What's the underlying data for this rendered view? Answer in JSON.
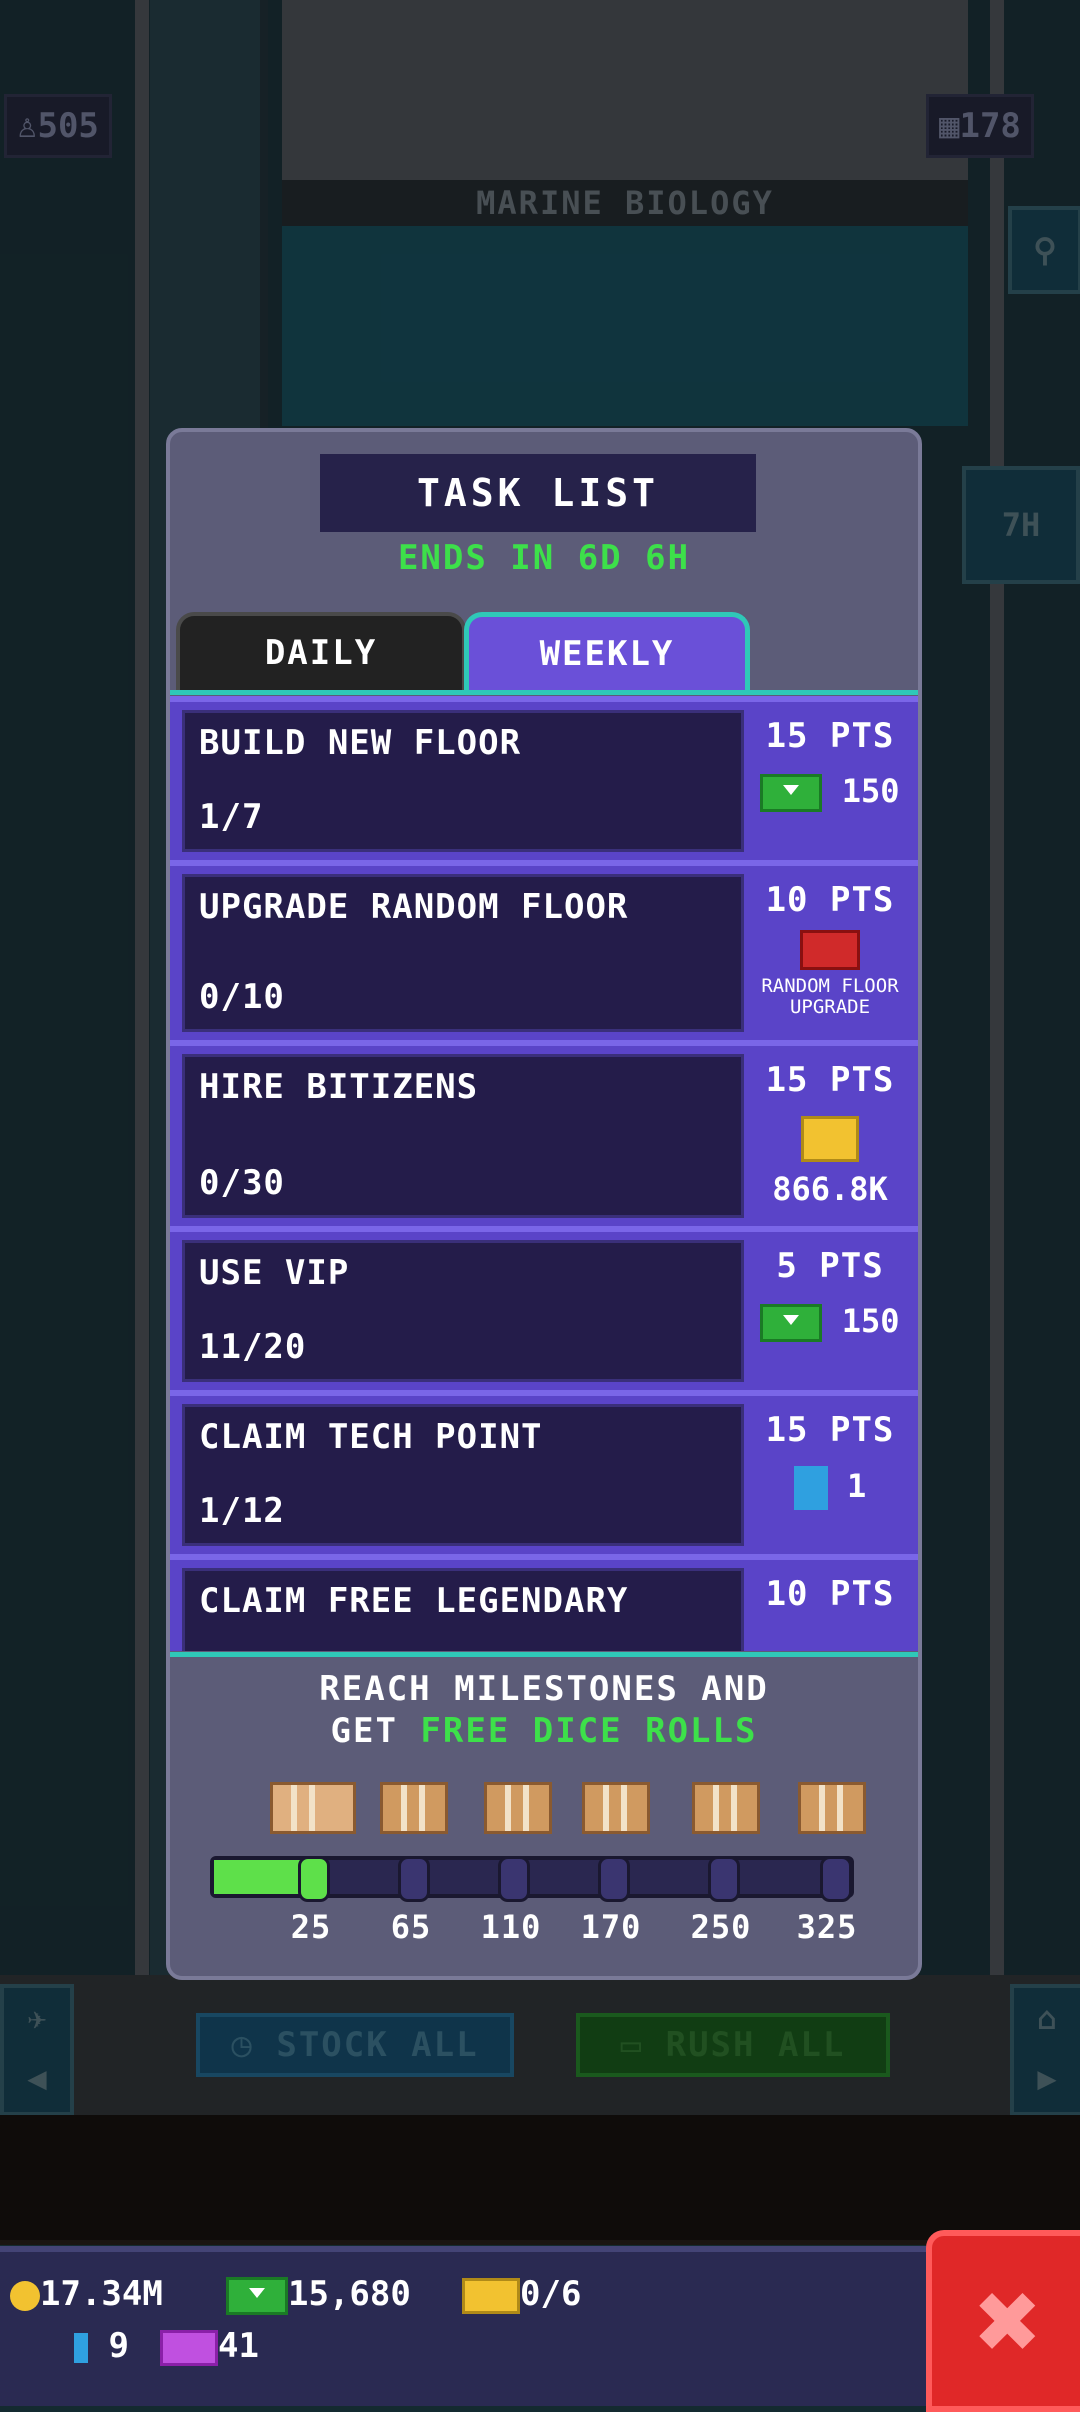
{
  "hud": {
    "population": "505",
    "floors": "178",
    "timer_badge": "7H",
    "floor_name": "MARINE BIOLOGY"
  },
  "actions": {
    "stock_all": "STOCK ALL",
    "rush_all": "RUSH ALL"
  },
  "modal": {
    "title": "TASK LIST",
    "ends": "ENDS IN 6D 6H",
    "tabs": [
      "DAILY",
      "WEEKLY"
    ],
    "active_tab": "WEEKLY",
    "tasks": [
      {
        "name": "BUILD NEW FLOOR",
        "progress": "1/7",
        "points": "15 PTS",
        "reward": "150",
        "reward_icon": "bux-icon"
      },
      {
        "name": "UPGRADE RANDOM FLOOR",
        "progress": "0/10",
        "points": "10 PTS",
        "reward": "RANDOM FLOOR UPGRADE",
        "reward_icon": "toolbox-icon"
      },
      {
        "name": "HIRE BITIZENS",
        "progress": "0/30",
        "points": "15 PTS",
        "reward": "866.8K",
        "reward_icon": "coins-icon"
      },
      {
        "name": "USE VIP",
        "progress": "11/20",
        "points": "5 PTS",
        "reward": "150",
        "reward_icon": "bux-icon"
      },
      {
        "name": "CLAIM TECH POINT",
        "progress": "1/12",
        "points": "15 PTS",
        "reward": "1",
        "reward_icon": "tech-point-icon"
      },
      {
        "name": "CLAIM FREE LEGENDARY",
        "progress": "",
        "points": "10 PTS",
        "reward": "",
        "reward_icon": ""
      }
    ],
    "milestones": {
      "line1": "REACH MILESTONES AND",
      "line2_prefix": "GET ",
      "line2_highlight": "FREE DICE ROLLS",
      "values": [
        "25",
        "65",
        "110",
        "170",
        "250",
        "325"
      ],
      "progress_fraction": 0.14,
      "first_box_opened": true
    }
  },
  "bottom": {
    "coins": "17.34M",
    "bux": "15,680",
    "golden_tickets": "0/6",
    "tech_points": "9",
    "vip_tickets": "41"
  },
  "colors": {
    "accent_green": "#3de04a",
    "tab_active": "#6a50d8",
    "teal_edge": "#2fc8b8",
    "close_red": "#e02828"
  }
}
